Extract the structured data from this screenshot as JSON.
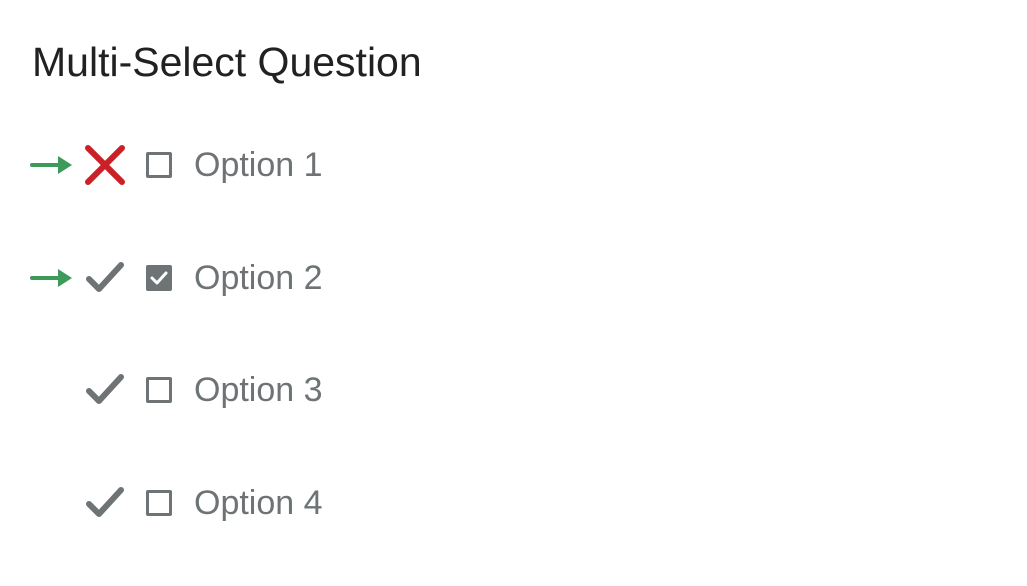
{
  "question": {
    "title": "Multi-Select Question"
  },
  "colors": {
    "arrow": "#3d9a5b",
    "incorrect": "#cd2026",
    "correct_mark": "#6e7376",
    "checkbox": "#6e7376",
    "text": "#6e7376",
    "title": "#202122"
  },
  "options": [
    {
      "label": "Option 1",
      "selected_indicator": "arrow-right-icon",
      "status_icon": "x-icon",
      "checked": false
    },
    {
      "label": "Option 2",
      "selected_indicator": "arrow-right-icon",
      "status_icon": "checkmark-icon",
      "checked": true
    },
    {
      "label": "Option 3",
      "selected_indicator": null,
      "status_icon": "checkmark-icon",
      "checked": false
    },
    {
      "label": "Option 4",
      "selected_indicator": null,
      "status_icon": "checkmark-icon",
      "checked": false
    }
  ]
}
